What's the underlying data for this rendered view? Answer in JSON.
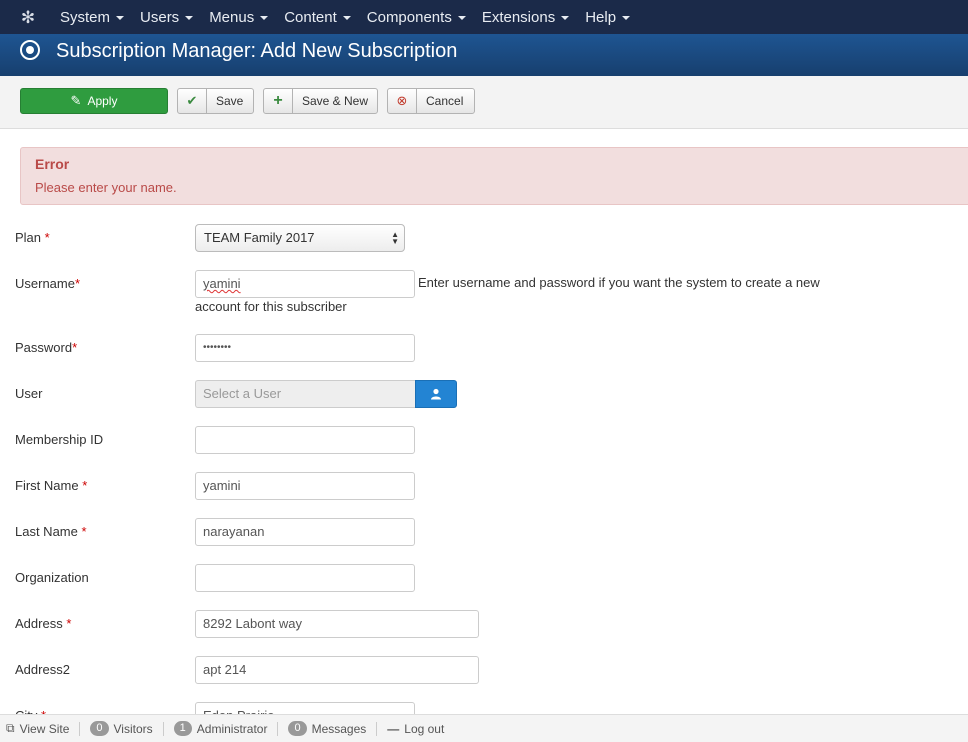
{
  "nav": {
    "items": [
      "System",
      "Users",
      "Menus",
      "Content",
      "Components",
      "Extensions",
      "Help"
    ]
  },
  "header": {
    "title": "Subscription Manager: Add New Subscription"
  },
  "toolbar": {
    "apply_label": "Apply",
    "save_label": "Save",
    "save_new_label": "Save & New",
    "cancel_label": "Cancel"
  },
  "alert": {
    "heading": "Error",
    "message": "Please enter your name."
  },
  "form": {
    "plan": {
      "label": "Plan",
      "value": "TEAM Family 2017"
    },
    "username": {
      "label": "Username",
      "value": "yamini",
      "help_line1": "Enter username and password if you want the system to create a new",
      "help_line2": "account for this subscriber"
    },
    "password": {
      "label": "Password",
      "value": "••••••••"
    },
    "user": {
      "label": "User",
      "placeholder": "Select a User"
    },
    "membership_id": {
      "label": "Membership ID",
      "value": ""
    },
    "first_name": {
      "label": "First Name",
      "value": "yamini"
    },
    "last_name": {
      "label": "Last Name",
      "value": "narayanan"
    },
    "organization": {
      "label": "Organization",
      "value": ""
    },
    "address": {
      "label": "Address",
      "value": "8292 Labont way"
    },
    "address2": {
      "label": "Address2",
      "value": "apt 214"
    },
    "city": {
      "label": "City",
      "value": "Eden Prairie"
    },
    "required_mark": "*"
  },
  "statusbar": {
    "view_site": "View Site",
    "visitors_count": "0",
    "visitors_label": "Visitors",
    "admin_count": "1",
    "admin_label": "Administrator",
    "messages_count": "0",
    "messages_label": "Messages",
    "logout_label": "Log out"
  }
}
